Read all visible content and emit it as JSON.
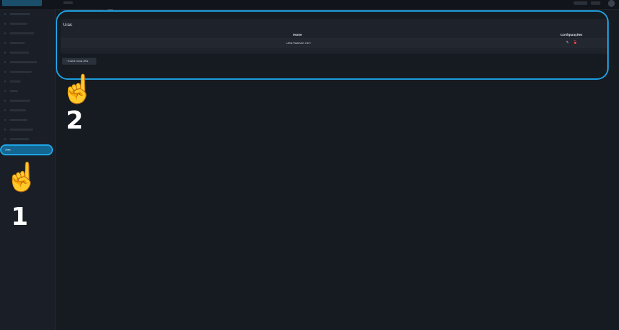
{
  "sidebar": {
    "active_label": "Uras"
  },
  "card": {
    "title": "Uras",
    "columns": [
      "Nome",
      "Configurações"
    ],
    "rows": [
      {
        "nome": "URA PADRAO CDT",
        "actions": [
          "edit-icon",
          "delete-icon"
        ]
      }
    ]
  },
  "actions": {
    "insert_label": "+ Inserir nova URA"
  },
  "annotations": {
    "step_1": "1",
    "step_2": "2",
    "pointer_glyph": "☝️"
  },
  "colors": {
    "highlight": "#1da1e2",
    "active_item": "#136691",
    "delete": "#e0443e",
    "background": "#161a21"
  }
}
